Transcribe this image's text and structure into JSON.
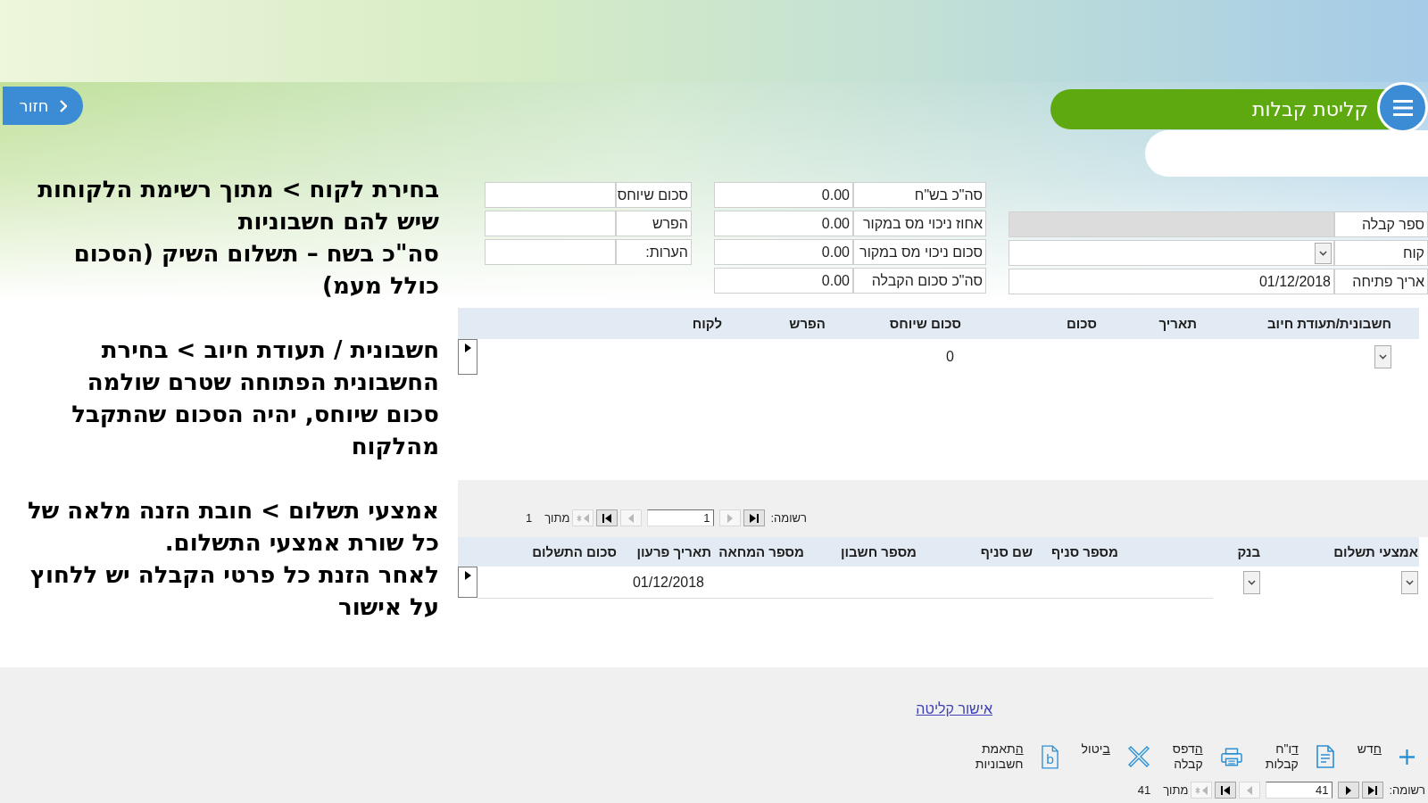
{
  "header": {
    "back_button": "חזור",
    "title": "קליטת קבלות"
  },
  "instructions": [
    {
      "paragraphs": [
        "בחירת לקוח > מתוך רשימת הלקוחות שיש להם חשבוניות",
        "סה\"כ בשח – תשלום השיק (הסכום כולל מעמ)"
      ]
    },
    {
      "paragraphs": [
        "חשבונית / תעודת חיוב > בחירת החשבונית הפתוחה שטרם שולמה",
        "סכום שיוחס, יהיה הסכום שהתקבל מהלקוח"
      ]
    },
    {
      "paragraphs": [
        "אמצעי תשלום > חובת הזנה מלאה של כל שורת אמצעי התשלום.",
        "לאחר הזנת כל פרטי הקבלה יש ללחוץ על אישור"
      ]
    }
  ],
  "form": {
    "columns": [
      {
        "fields": [
          {
            "label": "ספר קבלה",
            "kind": "readonly"
          },
          {
            "label": "קוח",
            "kind": "dropdown"
          },
          {
            "label": "אריך פתיחה",
            "kind": "text",
            "value": "01/12/2018"
          }
        ]
      },
      {
        "fields": [
          {
            "label": "סה\"כ בש\"ח",
            "kind": "text",
            "value": "0.00"
          },
          {
            "label": "אחוז ניכוי מס במקור",
            "kind": "text",
            "value": "0.00"
          },
          {
            "label": "סכום ניכוי מס במקור",
            "kind": "text",
            "value": "0.00"
          },
          {
            "label": "סה\"כ סכום הקבלה",
            "kind": "text",
            "value": "0.00"
          }
        ]
      },
      {
        "fields": [
          {
            "label": "סכום שיוחס",
            "kind": "text"
          },
          {
            "label": "הפרש",
            "kind": "text"
          },
          {
            "label": "הערות:",
            "kind": "text"
          }
        ]
      }
    ]
  },
  "invoices_table": {
    "columns": [
      "חשבונית/תעודת חיוב",
      "תאריך",
      "סכום",
      "סכום שיוחס",
      "הפרש",
      "לקוח"
    ],
    "rows": [
      {
        "cells": [
          {
            "kind": "dropdown"
          },
          {
            "kind": "text"
          },
          {
            "kind": "text"
          },
          {
            "kind": "text",
            "value": "0"
          },
          {
            "kind": "text"
          },
          {
            "kind": "text"
          }
        ]
      }
    ]
  },
  "invoices_pager": {
    "label": "רשומה:",
    "current": "1",
    "of_label": "מתוך",
    "total": "1",
    "buttons": [
      {
        "kind": "first",
        "disabled": false
      },
      {
        "kind": "previous",
        "disabled": true
      },
      {
        "kind": "next",
        "disabled": true
      },
      {
        "kind": "last",
        "disabled": false
      },
      {
        "kind": "new",
        "disabled": true
      }
    ]
  },
  "payments_table": {
    "columns": [
      "אמצעי תשלום",
      "בנק",
      "מספר סניף",
      "שם סניף",
      "מספר חשבון",
      "מספר המחאה",
      "תאריך פרעון",
      "סכום התשלום"
    ],
    "rows": [
      {
        "cells": [
          {
            "kind": "dropdown"
          },
          {
            "kind": "dropdown"
          },
          {
            "kind": "text"
          },
          {
            "kind": "text"
          },
          {
            "kind": "text"
          },
          {
            "kind": "text"
          },
          {
            "kind": "text",
            "value": "01/12/2018"
          },
          {
            "kind": "text"
          }
        ]
      }
    ]
  },
  "footer": {
    "link": "אישור קליטה",
    "toolbar": [
      {
        "kind": "new",
        "label": "חדש"
      },
      {
        "kind": "report",
        "label": "דו\"ח קבלות"
      },
      {
        "kind": "print",
        "label": "הדפס קבלה"
      },
      {
        "kind": "cancel",
        "label": "ביטול"
      },
      {
        "kind": "match",
        "label": "התאמת חשבוניות",
        "icon_text": "b"
      }
    ],
    "pager": {
      "label": "רשומה:",
      "current": "41",
      "of_label": "מתוך",
      "total": "41",
      "buttons": [
        {
          "kind": "first",
          "disabled": false
        },
        {
          "kind": "previous",
          "disabled": false
        },
        {
          "kind": "next",
          "disabled": true
        },
        {
          "kind": "last",
          "disabled": false
        },
        {
          "kind": "new",
          "disabled": true
        }
      ]
    }
  }
}
